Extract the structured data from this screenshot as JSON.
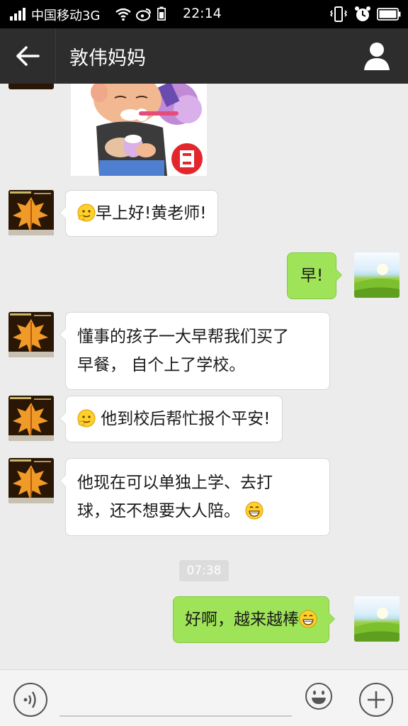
{
  "status_bar": {
    "carrier": "中国移动3G",
    "time": "22:14",
    "icons": [
      "signal-icon",
      "wifi-icon",
      "weibo-icon",
      "battery-small-icon",
      "vibrate-icon",
      "alarm-icon",
      "battery-icon"
    ]
  },
  "title_bar": {
    "title": "敦伟妈妈",
    "back_icon": "back-arrow-icon",
    "profile_icon": "person-icon"
  },
  "chat": {
    "messages": [
      {
        "direction": "in",
        "text": "早上好!黄老师!",
        "lead_emoji": "shy-smile-emoji"
      },
      {
        "direction": "out",
        "text": "早!"
      },
      {
        "direction": "in",
        "line1": "懂事的孩子一大早帮我们买了",
        "line2": "早餐， 自个上了学校。"
      },
      {
        "direction": "in",
        "text": " 他到校后帮忙报个平安!",
        "lead_emoji": "shy-smile-emoji"
      },
      {
        "direction": "in",
        "line1": "他现在可以单独上学、去打",
        "line2": "球，还不想要大人陪。",
        "trail_emoji": "grin-emoji"
      },
      {
        "direction": "out",
        "text": "好啊，越来越棒",
        "trail_emoji": "grin-emoji"
      }
    ],
    "timestamp": "07:38"
  },
  "input_bar": {
    "placeholder": "",
    "icons": [
      "voice-icon",
      "emoji-icon",
      "plus-icon"
    ]
  },
  "colors": {
    "status_bar_bg": "#000000",
    "title_bar_bg": "#2d2d2d",
    "chat_bg": "#ececec",
    "incoming_bubble": "#ffffff",
    "outgoing_bubble": "#9fe358"
  }
}
